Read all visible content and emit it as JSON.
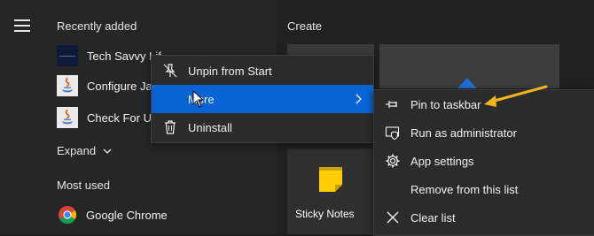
{
  "sidebar": {
    "recently_added_label": "Recently added",
    "recent_apps": [
      {
        "name": "Tech Savvy Lif",
        "icon": "tech-savvy-icon"
      },
      {
        "name": "Configure Jav",
        "icon": "java-icon"
      },
      {
        "name": "Check For Upc",
        "icon": "java-icon"
      }
    ],
    "expand_label": "Expand",
    "most_used_label": "Most used",
    "most_used_apps": [
      {
        "name": "Google Chrome",
        "icon": "chrome-icon"
      }
    ]
  },
  "tiles": {
    "group_label": "Create",
    "sticky_notes_label": "Sticky Notes"
  },
  "context_menu": {
    "items": [
      {
        "label": "Unpin from Start",
        "icon": "unpin-icon"
      },
      {
        "label": "More",
        "icon": "none",
        "active": true
      },
      {
        "label": "Uninstall",
        "icon": "trash-icon"
      }
    ]
  },
  "submenu": {
    "items": [
      {
        "label": "Pin to taskbar",
        "icon": "pin-icon"
      },
      {
        "label": "Run as administrator",
        "icon": "shield-admin-icon"
      },
      {
        "label": "App settings",
        "icon": "gear-icon"
      },
      {
        "label": "Remove from this list",
        "icon": "none"
      },
      {
        "label": "Clear list",
        "icon": "close-icon"
      }
    ]
  },
  "colors": {
    "accent": "#0a64d6",
    "annotation_arrow": "#f0b41c"
  }
}
